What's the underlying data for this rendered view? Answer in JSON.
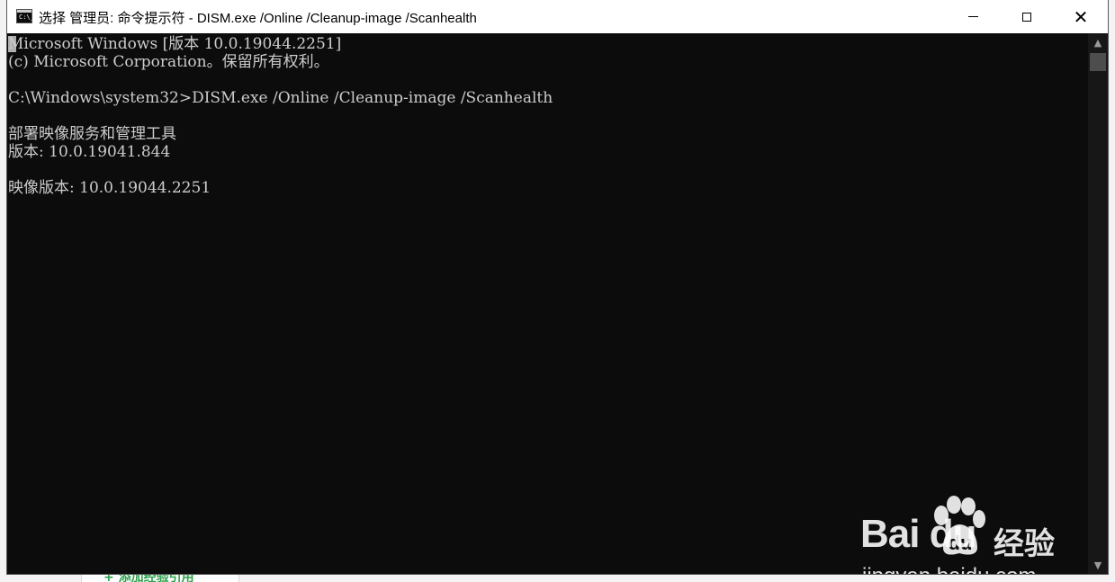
{
  "window": {
    "title": "选择 管理员: 命令提示符 - DISM.exe  /Online /Cleanup-image /Scanhealth",
    "icon": "cmd-icon",
    "icon_prompt": "C:\\_",
    "controls": {
      "minimize": "minimize-icon",
      "maximize": "maximize-icon",
      "close": "close-icon",
      "close_glyph": "✕"
    }
  },
  "console": {
    "lines": [
      "Microsoft Windows [版本 10.0.19044.2251]",
      "(c) Microsoft Corporation。保留所有权利。",
      "",
      "C:\\Windows\\system32>DISM.exe /Online /Cleanup-image /Scanhealth",
      "",
      "部署映像服务和管理工具",
      "版本: 10.0.19041.844",
      "",
      "映像版本: 10.0.19044.2251"
    ],
    "text_color": "#cccccc",
    "background_color": "#0c0c0c"
  },
  "scrollbar": {
    "up_glyph": "▲",
    "down_glyph": "▼"
  },
  "watermark": {
    "logo_text": "Bai  du",
    "product_text": "经验",
    "url_text": "jingyan.baidu.com"
  },
  "background_page": {
    "tab_label": "+ 添加经验引用",
    "accent_color": "#2ca24a"
  }
}
